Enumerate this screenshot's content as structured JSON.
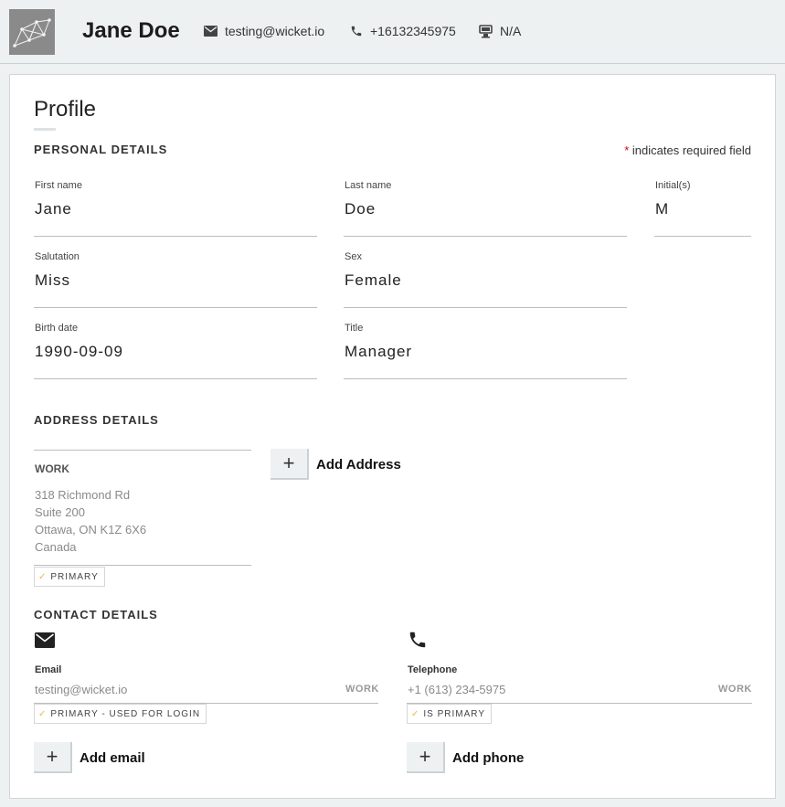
{
  "header": {
    "name": "Jane Doe",
    "email": "testing@wicket.io",
    "phone": "+16132345975",
    "fax": "N/A"
  },
  "profile": {
    "title": "Profile",
    "personal_heading": "PERSONAL DETAILS",
    "required_note": "indicates required field",
    "required_star": "*",
    "fields": {
      "first_name": {
        "label": "First name",
        "value": "Jane"
      },
      "last_name": {
        "label": "Last name",
        "value": "Doe"
      },
      "initials": {
        "label": "Initial(s)",
        "value": "M"
      },
      "salutation": {
        "label": "Salutation",
        "value": "Miss"
      },
      "sex": {
        "label": "Sex",
        "value": "Female"
      },
      "birth_date": {
        "label": "Birth date",
        "value": "1990-09-09"
      },
      "title": {
        "label": "Title",
        "value": "Manager"
      }
    }
  },
  "address": {
    "heading": "ADDRESS DETAILS",
    "type": "WORK",
    "lines": [
      "318 Richmond Rd",
      "Suite 200",
      "Ottawa, ON K1Z 6X6",
      "Canada"
    ],
    "primary_chip": "PRIMARY",
    "add_label": "Add Address"
  },
  "contact": {
    "heading": "CONTACT DETAILS",
    "email": {
      "label": "Email",
      "value": "testing@wicket.io",
      "type": "WORK",
      "chip": "PRIMARY - USED FOR LOGIN",
      "add_label": "Add email"
    },
    "telephone": {
      "label": "Telephone",
      "value": "+1 (613) 234-5975",
      "type": "WORK",
      "chip": "IS PRIMARY",
      "add_label": "Add phone"
    }
  },
  "icons": {
    "email": "envelope-icon",
    "phone": "phone-icon",
    "fax": "fax-icon",
    "check": "check-icon",
    "plus": "plus-icon"
  },
  "colors": {
    "background": "#eef1f2",
    "card": "#ffffff",
    "required": "#d0021b",
    "check": "#e8b84a"
  }
}
